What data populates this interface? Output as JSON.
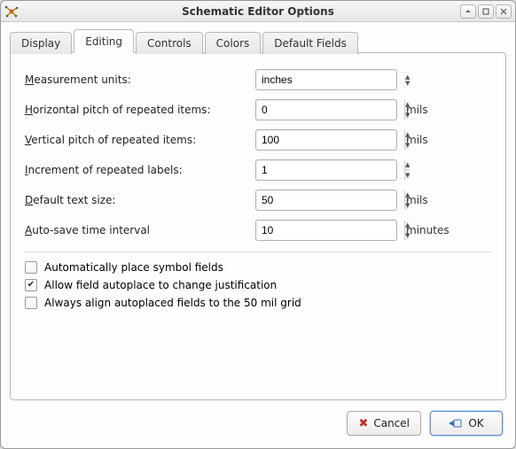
{
  "window": {
    "title": "Schematic Editor Options"
  },
  "tabs": [
    "Display",
    "Editing",
    "Controls",
    "Colors",
    "Default Fields"
  ],
  "active_tab": 1,
  "form": {
    "units": {
      "label": "Measurement units:",
      "underline_index": 0,
      "value": "inches"
    },
    "hpitch": {
      "label": "Horizontal pitch of repeated items:",
      "underline_index": 0,
      "value": "0",
      "suffix": "mils"
    },
    "vpitch": {
      "label": "Vertical pitch of repeated items:",
      "underline_index": 0,
      "value": "100",
      "suffix": "mils"
    },
    "increment": {
      "label": "Increment of repeated labels:",
      "underline_index": 0,
      "value": "1"
    },
    "textsize": {
      "label": "Default text size:",
      "underline_index": 0,
      "value": "50",
      "suffix": "mils"
    },
    "autosave": {
      "label": "Auto-save time interval",
      "underline_index": 0,
      "value": "10",
      "suffix": "minutes"
    }
  },
  "checks": {
    "autoplace": {
      "label": "Automatically place symbol fields",
      "underline_index": 1,
      "checked": false
    },
    "justification": {
      "label": "Allow field autoplace to change justification",
      "underline_index": 1,
      "checked": true
    },
    "align50": {
      "label": "Always align autoplaced fields to the 50 mil grid",
      "underline_index": 2,
      "checked": false
    }
  },
  "buttons": {
    "cancel": "Cancel",
    "ok": "OK",
    "ok_underline_index": 0
  }
}
